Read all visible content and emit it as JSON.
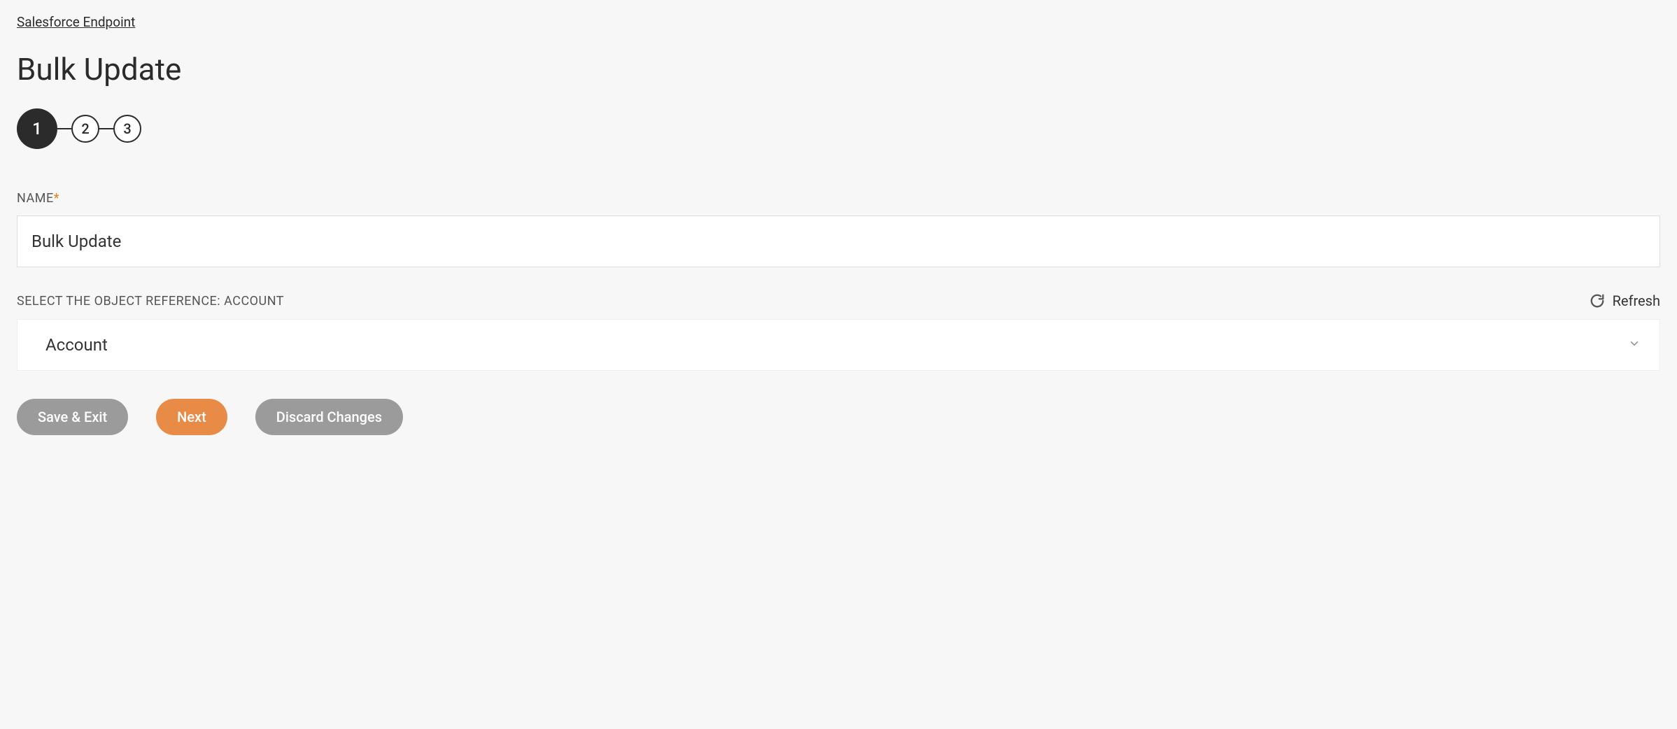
{
  "breadcrumb": "Salesforce Endpoint",
  "page_title": "Bulk Update",
  "stepper": {
    "steps": [
      "1",
      "2",
      "3"
    ],
    "active_index": 0
  },
  "fields": {
    "name": {
      "label": "NAME",
      "required": true,
      "value": "Bulk Update"
    },
    "object_ref": {
      "label": "SELECT THE OBJECT REFERENCE: ACCOUNT",
      "value": "Account",
      "refresh_label": "Refresh"
    }
  },
  "buttons": {
    "save_exit": "Save & Exit",
    "next": "Next",
    "discard": "Discard Changes"
  }
}
